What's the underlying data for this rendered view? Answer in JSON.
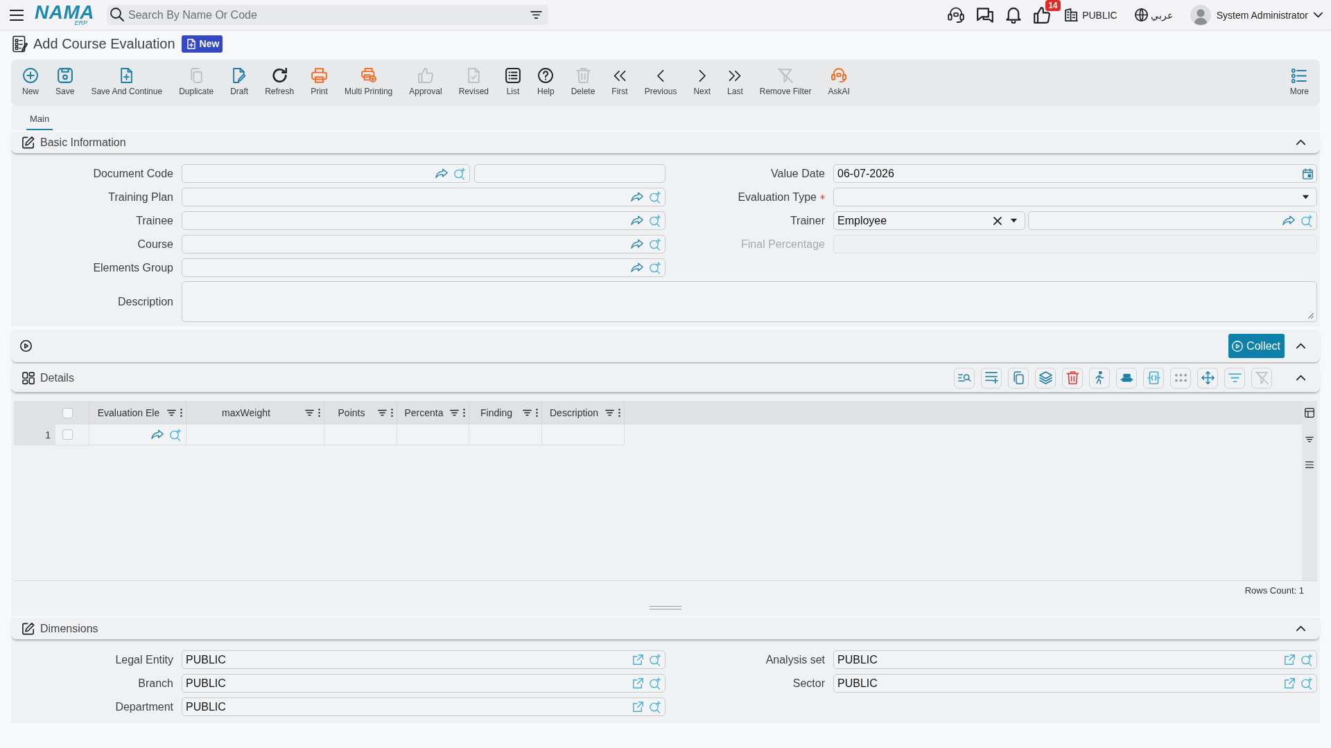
{
  "top_bar": {
    "logo": {
      "name": "NAMA",
      "suffix": "ERP"
    },
    "search": {
      "placeholder": "Search By Name Or Code"
    },
    "notification_count": "14",
    "company": "PUBLIC",
    "language": "عربي",
    "user": "System Administrator"
  },
  "page": {
    "title": "Add Course Evaluation",
    "status": "New"
  },
  "toolbar": [
    {
      "kind": "new",
      "label": "New",
      "disabled": false
    },
    {
      "kind": "save",
      "label": "Save",
      "disabled": false
    },
    {
      "kind": "save_continue",
      "label": "Save And Continue",
      "disabled": false
    },
    {
      "kind": "duplicate",
      "label": "Duplicate",
      "disabled": true
    },
    {
      "kind": "draft",
      "label": "Draft",
      "disabled": false
    },
    {
      "kind": "refresh",
      "label": "Refresh",
      "disabled": false
    },
    {
      "kind": "print",
      "label": "Print",
      "disabled": false
    },
    {
      "kind": "multi_print",
      "label": "Multi Printing",
      "disabled": false
    },
    {
      "kind": "approval",
      "label": "Approval",
      "disabled": true
    },
    {
      "kind": "revised",
      "label": "Revised",
      "disabled": true
    },
    {
      "kind": "list",
      "label": "List",
      "disabled": false
    },
    {
      "kind": "help",
      "label": "Help",
      "disabled": false
    },
    {
      "kind": "delete",
      "label": "Delete",
      "disabled": true
    },
    {
      "kind": "first",
      "label": "First",
      "disabled": false
    },
    {
      "kind": "previous",
      "label": "Previous",
      "disabled": false
    },
    {
      "kind": "next",
      "label": "Next",
      "disabled": false
    },
    {
      "kind": "last",
      "label": "Last",
      "disabled": false
    },
    {
      "kind": "remove_filter",
      "label": "Remove Filter",
      "disabled": true
    },
    {
      "kind": "ask_ai",
      "label": "AskAI",
      "disabled": false
    },
    {
      "kind": "more",
      "label": "More",
      "disabled": false
    }
  ],
  "tabs": [
    {
      "label": "Main",
      "selected": true
    }
  ],
  "basic_information": {
    "title": "Basic Information",
    "left_fields": [
      {
        "label": "Document Code",
        "kind": "code",
        "required": false,
        "disabled": false
      },
      {
        "label": "Training Plan",
        "kind": "lookup",
        "required": false,
        "disabled": false
      },
      {
        "label": "Trainee",
        "kind": "lookup",
        "required": false,
        "disabled": false
      },
      {
        "label": "Course",
        "kind": "lookup",
        "required": false,
        "disabled": false
      },
      {
        "label": "Elements Group",
        "kind": "lookup",
        "required": false,
        "disabled": false
      }
    ],
    "right_fields": [
      {
        "label": "Value Date",
        "kind": "date",
        "value": "06-07-2026",
        "required": false,
        "disabled": false
      },
      {
        "label": "Evaluation Type",
        "kind": "select",
        "required": true,
        "disabled": false
      },
      {
        "label": "Trainer",
        "kind": "typed_lookup",
        "value": "Employee",
        "required": false,
        "disabled": false
      },
      {
        "label": "Final Percentage",
        "kind": "number",
        "required": false,
        "disabled": true
      }
    ],
    "description": {
      "label": "Description"
    }
  },
  "actions": {
    "button": "Collect"
  },
  "details": {
    "title": "Details",
    "tools": [
      {
        "kind": "find",
        "disabled": false
      },
      {
        "kind": "add_row",
        "disabled": false
      },
      {
        "kind": "copy",
        "disabled": false
      },
      {
        "kind": "layers",
        "disabled": false
      },
      {
        "kind": "delete",
        "disabled": false
      },
      {
        "kind": "run",
        "disabled": false
      },
      {
        "kind": "stack",
        "disabled": false
      },
      {
        "kind": "frame",
        "disabled": false
      },
      {
        "kind": "dots",
        "disabled": false
      },
      {
        "kind": "move",
        "disabled": false
      },
      {
        "kind": "filter",
        "disabled": false
      },
      {
        "kind": "remove_filter",
        "disabled": true
      }
    ],
    "table": {
      "select_all": {
        "checked": false
      },
      "columns": [
        {
          "label": "Evaluation Ele",
          "kind": "lookup"
        },
        {
          "label": "maxWeight",
          "kind": "plain"
        },
        {
          "label": "Points",
          "kind": "plain"
        },
        {
          "label": "Percenta",
          "kind": "plain"
        },
        {
          "label": "Finding",
          "kind": "plain"
        },
        {
          "label": "Description",
          "kind": "plain"
        }
      ],
      "rows": [
        {
          "number": "1",
          "checked": false
        }
      ],
      "rows_count": "Rows Count: 1"
    }
  },
  "dimensions": {
    "title": "Dimensions",
    "left_fields": [
      {
        "label": "Legal Entity",
        "value": "PUBLIC"
      },
      {
        "label": "Branch",
        "value": "PUBLIC"
      },
      {
        "label": "Department",
        "value": "PUBLIC"
      }
    ],
    "right_fields": [
      {
        "label": "Analysis set",
        "value": "PUBLIC"
      },
      {
        "label": "Sector",
        "value": "PUBLIC"
      }
    ]
  }
}
